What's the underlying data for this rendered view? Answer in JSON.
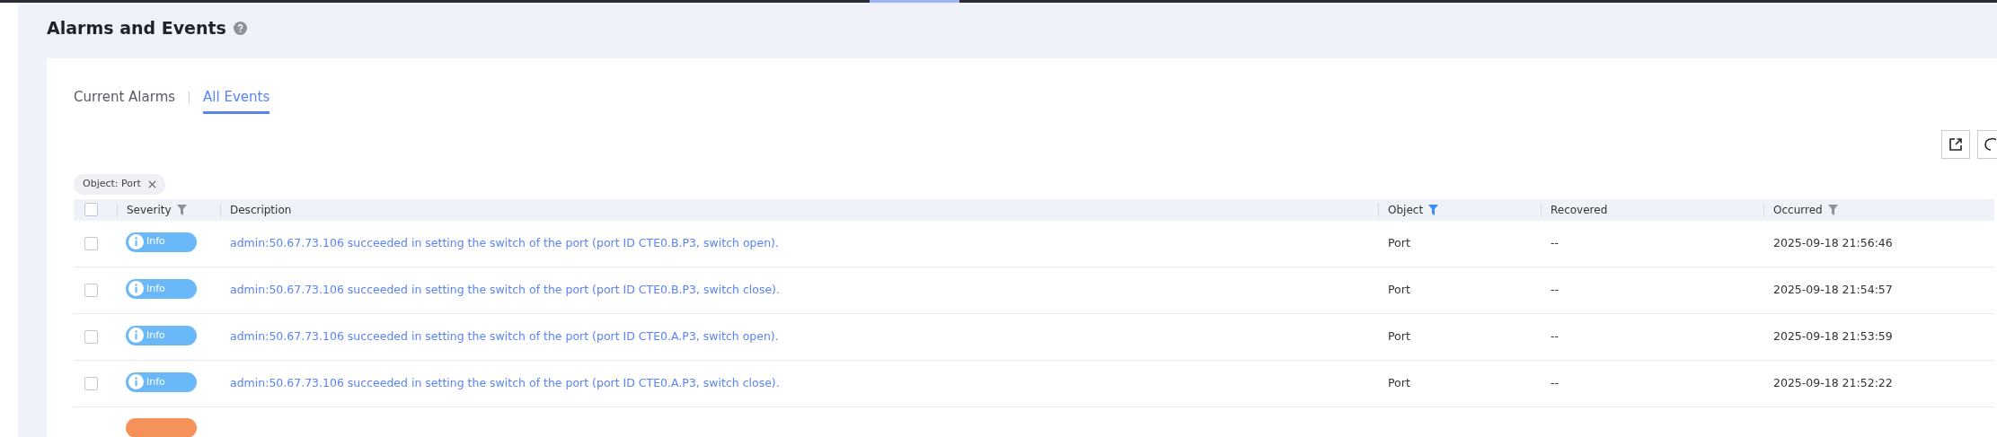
{
  "page": {
    "title": "Alarms and Events"
  },
  "tabs": [
    {
      "label": "Current Alarms",
      "selected": false
    },
    {
      "label": "All Events",
      "selected": true
    }
  ],
  "filter_chips": [
    {
      "label": "Object: Port"
    }
  ],
  "table": {
    "header_checkbox": {
      "checked": false
    },
    "columns": [
      {
        "label": "Severity",
        "filter": {
          "active": false
        }
      },
      {
        "label": "Description"
      },
      {
        "label": "Object",
        "filter": {
          "active": true
        }
      },
      {
        "label": "Recovered"
      },
      {
        "label": "Occurred",
        "filter": {
          "active": false
        }
      }
    ],
    "rows": [
      {
        "checked": false,
        "severity": {
          "kind": "info",
          "label": "Info"
        },
        "description": "admin:50.67.73.106 succeeded in setting the switch of the port (port ID CTE0.B.P3, switch open).",
        "object": "Port",
        "recovered": "--",
        "occurred": "2025-09-18 21:56:46"
      },
      {
        "checked": false,
        "severity": {
          "kind": "info",
          "label": "Info"
        },
        "description": "admin:50.67.73.106 succeeded in setting the switch of the port (port ID CTE0.B.P3, switch close).",
        "object": "Port",
        "recovered": "--",
        "occurred": "2025-09-18 21:54:57"
      },
      {
        "checked": false,
        "severity": {
          "kind": "info",
          "label": "Info"
        },
        "description": "admin:50.67.73.106 succeeded in setting the switch of the port (port ID CTE0.A.P3, switch open).",
        "object": "Port",
        "recovered": "--",
        "occurred": "2025-09-18 21:53:59"
      },
      {
        "checked": false,
        "severity": {
          "kind": "info",
          "label": "Info"
        },
        "description": "admin:50.67.73.106 succeeded in setting the switch of the port (port ID CTE0.A.P3, switch close).",
        "object": "Port",
        "recovered": "--",
        "occurred": "2025-09-18 21:52:22"
      },
      {
        "severity": {
          "kind": "major"
        }
      }
    ]
  }
}
